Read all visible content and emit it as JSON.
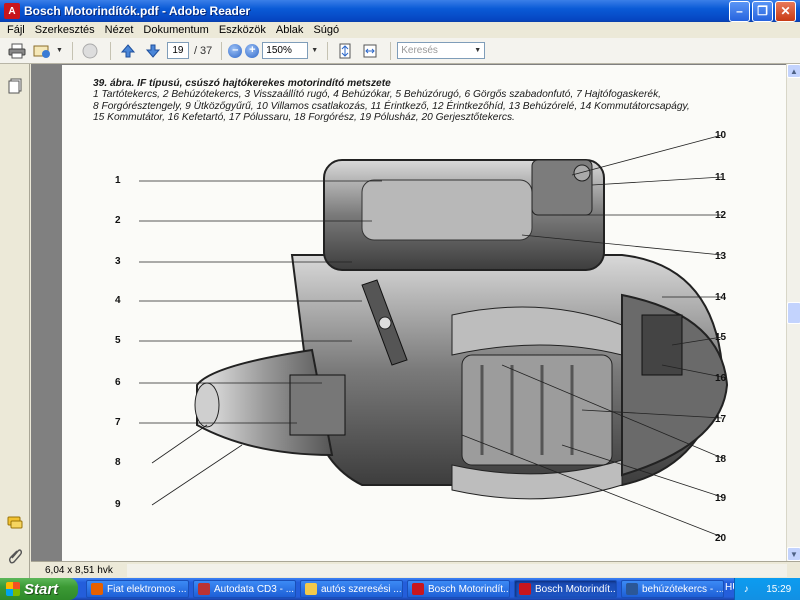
{
  "window": {
    "title": "Bosch Motorindítók.pdf - Adobe Reader"
  },
  "menu": [
    "Fájl",
    "Szerkesztés",
    "Nézet",
    "Dokumentum",
    "Eszközök",
    "Ablak",
    "Súgó"
  ],
  "toolbar": {
    "page_current": "19",
    "page_total": "/ 37",
    "zoom": "150%",
    "search_placeholder": "Keresés"
  },
  "document": {
    "caption_title": "39. ábra. IF típusú, csúszó hajtókerekes motorindító metszete",
    "caption_line1": "1 Tartótekercs, 2 Behúzótekercs, 3 Visszaállító rugó, 4 Behúzókar, 5 Behúzórugó, 6 Görgős szabadonfutó, 7 Hajtófogaskerék,",
    "caption_line2": "8 Forgórésztengely, 9 Ütközőgyűrű, 10 Villamos csatlakozás, 11 Érintkező, 12 Érintkezőhíd, 13 Behúzórelé, 14 Kommutátorcsapágy,",
    "caption_line3": "15 Kommutátor, 16 Kefetartó, 17 Pólussaru, 18 Forgórész, 19 Pólusház, 20 Gerjesztőtekercs.",
    "callouts_left": [
      "1",
      "2",
      "3",
      "4",
      "5",
      "6",
      "7",
      "8",
      "9"
    ],
    "callouts_right": [
      "10",
      "11",
      "12",
      "13",
      "14",
      "15",
      "16",
      "17",
      "18",
      "19",
      "20"
    ]
  },
  "status": {
    "page_size": "6,04 x 8,51 hvk"
  },
  "taskbar": {
    "start": "Start",
    "tasks": [
      "Fiat elektromos ...",
      "Autodata CD3 - ...",
      "autós szeresési ...",
      "Bosch Motorindít...",
      "Bosch Motorindít...",
      "behúzótekercs - ..."
    ],
    "language": "HU",
    "clock": "15:29"
  }
}
